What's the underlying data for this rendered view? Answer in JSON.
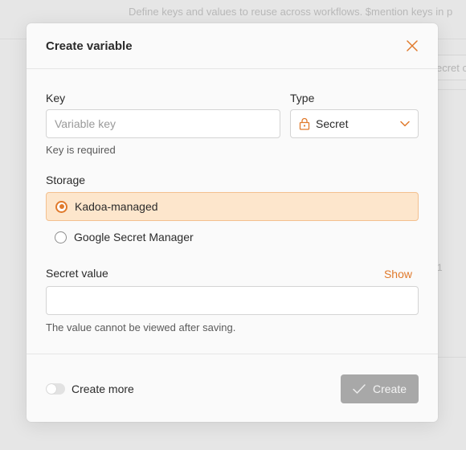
{
  "background": {
    "description": "Define keys and values to reuse across workflows. $mention keys in p",
    "input_text": "ecret c",
    "row_number": "1"
  },
  "modal": {
    "title": "Create variable",
    "key": {
      "label": "Key",
      "placeholder": "Variable key",
      "value": "",
      "error": "Key is required"
    },
    "type": {
      "label": "Type",
      "selected": "Secret",
      "icon": "lock-icon"
    },
    "storage": {
      "label": "Storage",
      "options": [
        {
          "label": "Kadoa-managed",
          "selected": true
        },
        {
          "label": "Google Secret Manager",
          "selected": false
        }
      ]
    },
    "secret": {
      "label": "Secret value",
      "show_label": "Show",
      "value": "",
      "help": "The value cannot be viewed after saving."
    },
    "footer": {
      "create_more_label": "Create more",
      "create_more_on": false,
      "create_label": "Create"
    }
  },
  "colors": {
    "accent": "#e07a2c",
    "selected_bg": "#fde6cc",
    "disabled_button": "#a8a8a8"
  }
}
